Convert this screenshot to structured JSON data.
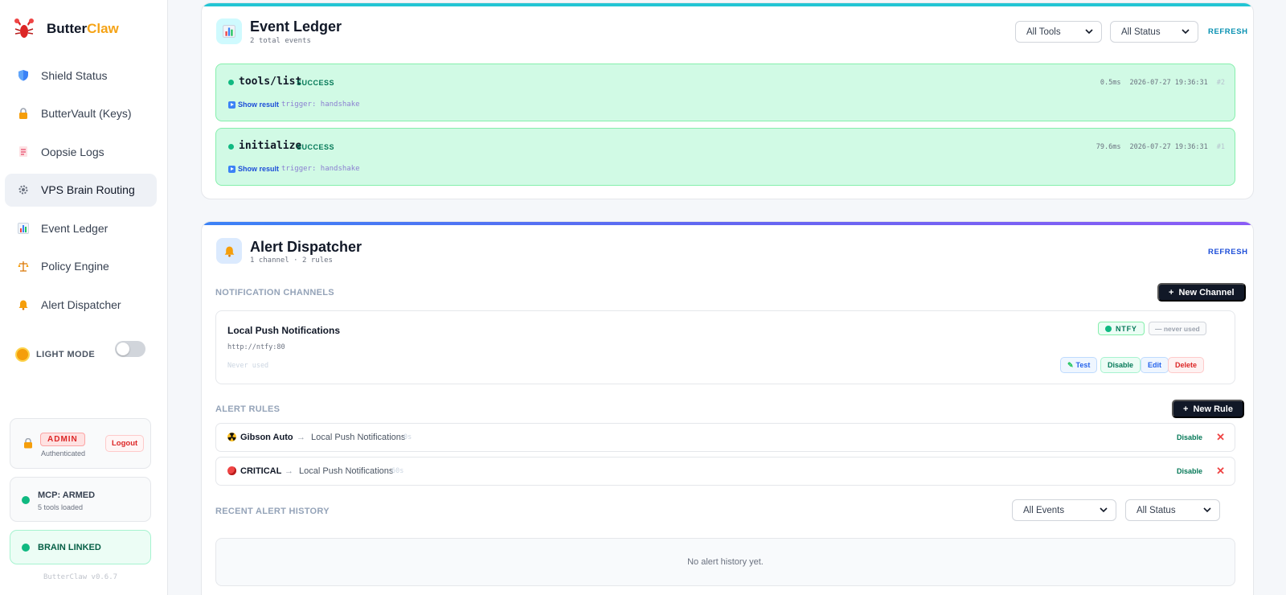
{
  "brand": {
    "name_main": "Butter",
    "name_accent": "Claw",
    "logo_icon": "lobster-icon",
    "accent_color": "#f5a316"
  },
  "nav": [
    {
      "label": "Shield Status",
      "icon": "shield-icon"
    },
    {
      "label": "ButterVault (Keys)",
      "icon": "lock-icon"
    },
    {
      "label": "Oopsie Logs",
      "icon": "memo-icon"
    },
    {
      "label": "VPS Brain Routing",
      "icon": "gear-icon",
      "active": true
    },
    {
      "label": "Event Ledger",
      "icon": "bar-chart-icon"
    },
    {
      "label": "Policy Engine",
      "icon": "scales-icon"
    },
    {
      "label": "Alert Dispatcher",
      "icon": "bell-icon"
    }
  ],
  "theme": {
    "label": "LIGHT MODE",
    "toggle_on": false
  },
  "admin": {
    "badge": "ADMIN",
    "sub": "Authenticated",
    "logout": "Logout"
  },
  "mcp": {
    "title": "MCP: ARMED",
    "sub": "5 tools loaded"
  },
  "brain": {
    "title": "BRAIN LINKED"
  },
  "version": "ButterClaw v0.6.7",
  "ledger": {
    "title": "Event Ledger",
    "sub": "2 total events",
    "filter_tools": "All Tools",
    "filter_status": "All Status",
    "refresh": "REFRESH",
    "accent": "#22c5d4",
    "events": [
      {
        "name": "tools/list",
        "status": "SUCCESS",
        "duration": "0.5ms",
        "timestamp": "2026-07-27 19:36:31",
        "id": "#2",
        "show": "Show result",
        "trigger": "trigger: handshake"
      },
      {
        "name": "initialize",
        "status": "SUCCESS",
        "duration": "79.6ms",
        "timestamp": "2026-07-27 19:36:31",
        "id": "#1",
        "show": "Show result",
        "trigger": "trigger: handshake"
      }
    ]
  },
  "alerts": {
    "title": "Alert Dispatcher",
    "sub": "1 channel · 2 rules",
    "refresh": "REFRESH",
    "channels_label": "NOTIFICATION CHANNELS",
    "new_channel": "New Channel",
    "channel": {
      "name": "Local Push Notifications",
      "url": "http://ntfy:80",
      "used": "Never used",
      "type_badge": "NTFY",
      "usage_badge": "— never used",
      "btn_test": "Test",
      "btn_disable": "Disable",
      "btn_edit": "Edit",
      "btn_delete": "Delete"
    },
    "rules_label": "ALERT RULES",
    "new_rule": "New Rule",
    "rules": [
      {
        "name": "Gibson Auto",
        "icon": "radioactive-icon",
        "arrow": "→",
        "target": "Local Push Notifications",
        "cooldown": "0s",
        "disable": "Disable"
      },
      {
        "name": "CRITICAL",
        "icon": "red-circle-icon",
        "arrow": "→",
        "target": "Local Push Notifications",
        "cooldown": "60s",
        "disable": "Disable"
      }
    ],
    "history_label": "RECENT ALERT HISTORY",
    "filter_events": "All Events",
    "filter_status": "All Status",
    "empty": "No alert history yet."
  }
}
